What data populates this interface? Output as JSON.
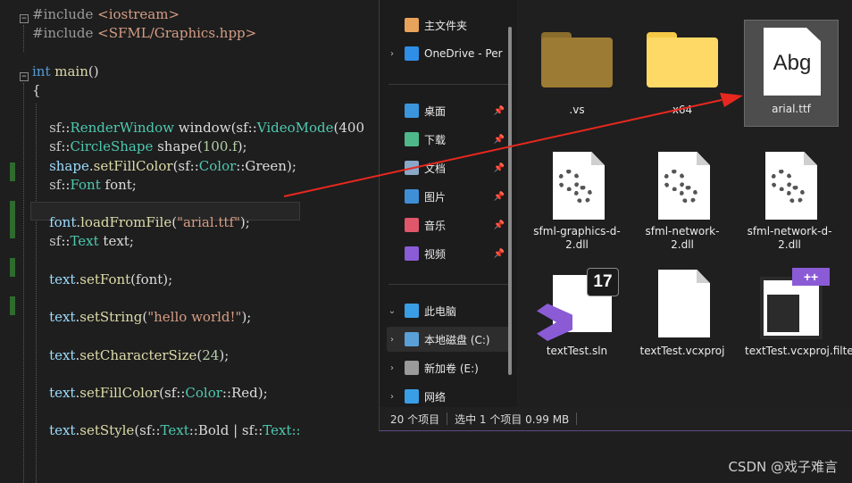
{
  "editor": {
    "lines": [
      [
        {
          "t": "#include ",
          "c": "pp"
        },
        {
          "t": "<iostream>",
          "c": "str"
        }
      ],
      [
        {
          "t": "#include ",
          "c": "pp"
        },
        {
          "t": "<SFML/Graphics.hpp>",
          "c": "str"
        }
      ],
      [],
      [
        {
          "t": "int ",
          "c": "kw"
        },
        {
          "t": "main",
          "c": "fn"
        },
        {
          "t": "()",
          "c": "txt"
        }
      ],
      [
        {
          "t": "{",
          "c": "txt"
        }
      ],
      [],
      [
        {
          "t": "    sf",
          "c": "ns"
        },
        {
          "t": "::",
          "c": "txt"
        },
        {
          "t": "RenderWindow ",
          "c": "type"
        },
        {
          "t": "window",
          "c": "txt"
        },
        {
          "t": "(sf::",
          "c": "txt"
        },
        {
          "t": "VideoMode",
          "c": "type"
        },
        {
          "t": "(400",
          "c": "txt"
        }
      ],
      [
        {
          "t": "    sf",
          "c": "ns"
        },
        {
          "t": "::",
          "c": "txt"
        },
        {
          "t": "CircleShape ",
          "c": "type"
        },
        {
          "t": "shape",
          "c": "txt"
        },
        {
          "t": "(",
          "c": "txt"
        },
        {
          "t": "100.f",
          "c": "num"
        },
        {
          "t": ");",
          "c": "txt"
        }
      ],
      [
        {
          "t": "    shape",
          "c": "var"
        },
        {
          "t": ".",
          "c": "txt"
        },
        {
          "t": "setFillColor",
          "c": "fn"
        },
        {
          "t": "(sf::",
          "c": "txt"
        },
        {
          "t": "Color",
          "c": "type"
        },
        {
          "t": "::Green);",
          "c": "txt"
        }
      ],
      [
        {
          "t": "    sf",
          "c": "ns"
        },
        {
          "t": "::",
          "c": "txt"
        },
        {
          "t": "Font ",
          "c": "type"
        },
        {
          "t": "font;",
          "c": "txt"
        }
      ],
      [],
      [
        {
          "t": "    font",
          "c": "var"
        },
        {
          "t": ".",
          "c": "txt"
        },
        {
          "t": "loadFromFile",
          "c": "fn"
        },
        {
          "t": "(",
          "c": "txt"
        },
        {
          "t": "\"arial.ttf\"",
          "c": "str"
        },
        {
          "t": ");",
          "c": "txt"
        }
      ],
      [
        {
          "t": "    sf",
          "c": "ns"
        },
        {
          "t": "::",
          "c": "txt"
        },
        {
          "t": "Text ",
          "c": "type"
        },
        {
          "t": "text;",
          "c": "txt"
        }
      ],
      [],
      [
        {
          "t": "    text",
          "c": "var"
        },
        {
          "t": ".",
          "c": "txt"
        },
        {
          "t": "setFont",
          "c": "fn"
        },
        {
          "t": "(font);",
          "c": "txt"
        }
      ],
      [],
      [
        {
          "t": "    text",
          "c": "var"
        },
        {
          "t": ".",
          "c": "txt"
        },
        {
          "t": "setString",
          "c": "fn"
        },
        {
          "t": "(",
          "c": "txt"
        },
        {
          "t": "\"hello world!\"",
          "c": "str"
        },
        {
          "t": ");",
          "c": "txt"
        }
      ],
      [],
      [
        {
          "t": "    text",
          "c": "var"
        },
        {
          "t": ".",
          "c": "txt"
        },
        {
          "t": "setCharacterSize",
          "c": "fn"
        },
        {
          "t": "(",
          "c": "txt"
        },
        {
          "t": "24",
          "c": "num"
        },
        {
          "t": ");",
          "c": "txt"
        }
      ],
      [],
      [
        {
          "t": "    text",
          "c": "var"
        },
        {
          "t": ".",
          "c": "txt"
        },
        {
          "t": "setFillColor",
          "c": "fn"
        },
        {
          "t": "(sf::",
          "c": "txt"
        },
        {
          "t": "Color",
          "c": "type"
        },
        {
          "t": "::Red);",
          "c": "txt"
        }
      ],
      [],
      [
        {
          "t": "    text",
          "c": "var"
        },
        {
          "t": ".",
          "c": "txt"
        },
        {
          "t": "setStyle",
          "c": "fn"
        },
        {
          "t": "(sf::",
          "c": "txt"
        },
        {
          "t": "Text",
          "c": "type"
        },
        {
          "t": "::Bold | sf::",
          "c": "txt"
        },
        {
          "t": "Text::",
          "c": "type"
        }
      ]
    ]
  },
  "explorer": {
    "nav": [
      {
        "label": "主文件夹",
        "icon": "home-icon",
        "color": "#e8a35a",
        "chev": "",
        "pin": false
      },
      {
        "label": "OneDrive - Per",
        "icon": "onedrive-icon",
        "color": "#2f8ee6",
        "chev": "›",
        "pin": false
      },
      {
        "label": "桌面",
        "icon": "desktop-icon",
        "color": "#3a95dd",
        "chev": "",
        "pin": true
      },
      {
        "label": "下载",
        "icon": "download-icon",
        "color": "#4fb88a",
        "chev": "",
        "pin": true
      },
      {
        "label": "文档",
        "icon": "document-icon",
        "color": "#8aa7c8",
        "chev": "",
        "pin": true
      },
      {
        "label": "图片",
        "icon": "pictures-icon",
        "color": "#3f8fd6",
        "chev": "",
        "pin": true
      },
      {
        "label": "音乐",
        "icon": "music-icon",
        "color": "#e0566b",
        "chev": "",
        "pin": true
      },
      {
        "label": "视频",
        "icon": "video-icon",
        "color": "#8a5cd6",
        "chev": "",
        "pin": true
      },
      {
        "label": "此电脑",
        "icon": "this-pc-icon",
        "color": "#3a9ee6",
        "chev": "⌄",
        "pin": false
      },
      {
        "label": "本地磁盘 (C:)",
        "icon": "drive-c-icon",
        "color": "#5aa0d6",
        "chev": "›",
        "pin": false
      },
      {
        "label": "新加卷 (E:)",
        "icon": "drive-e-icon",
        "color": "#9a9a9a",
        "chev": "›",
        "pin": false
      },
      {
        "label": "网络",
        "icon": "network-icon",
        "color": "#3a9ee6",
        "chev": "›",
        "pin": false
      }
    ],
    "files": [
      {
        "label": ".vs",
        "kind": "folder-dim"
      },
      {
        "label": "x64",
        "kind": "folder"
      },
      {
        "label": "arial.ttf",
        "kind": "font",
        "preview": "Abg"
      },
      {
        "label": "sfml-graphics-d-2.dll",
        "kind": "dll"
      },
      {
        "label": "sfml-network-2.dll",
        "kind": "dll"
      },
      {
        "label": "sfml-network-d-2.dll",
        "kind": "dll"
      },
      {
        "label": "textTest.sln",
        "kind": "sln",
        "badge": "17"
      },
      {
        "label": "textTest.vcxproj",
        "kind": "blank"
      },
      {
        "label": "textTest.vcxproj.filters",
        "kind": "filters",
        "badge": "++"
      }
    ],
    "status": {
      "count": "20 个项目",
      "selection": "选中 1 个项目  0.99 MB"
    }
  },
  "watermark": "CSDN @戏子难言",
  "colors": {
    "arrow": "#e8281f",
    "selection": "#4d4d4d",
    "gutter_change": "#2f6b2f"
  }
}
